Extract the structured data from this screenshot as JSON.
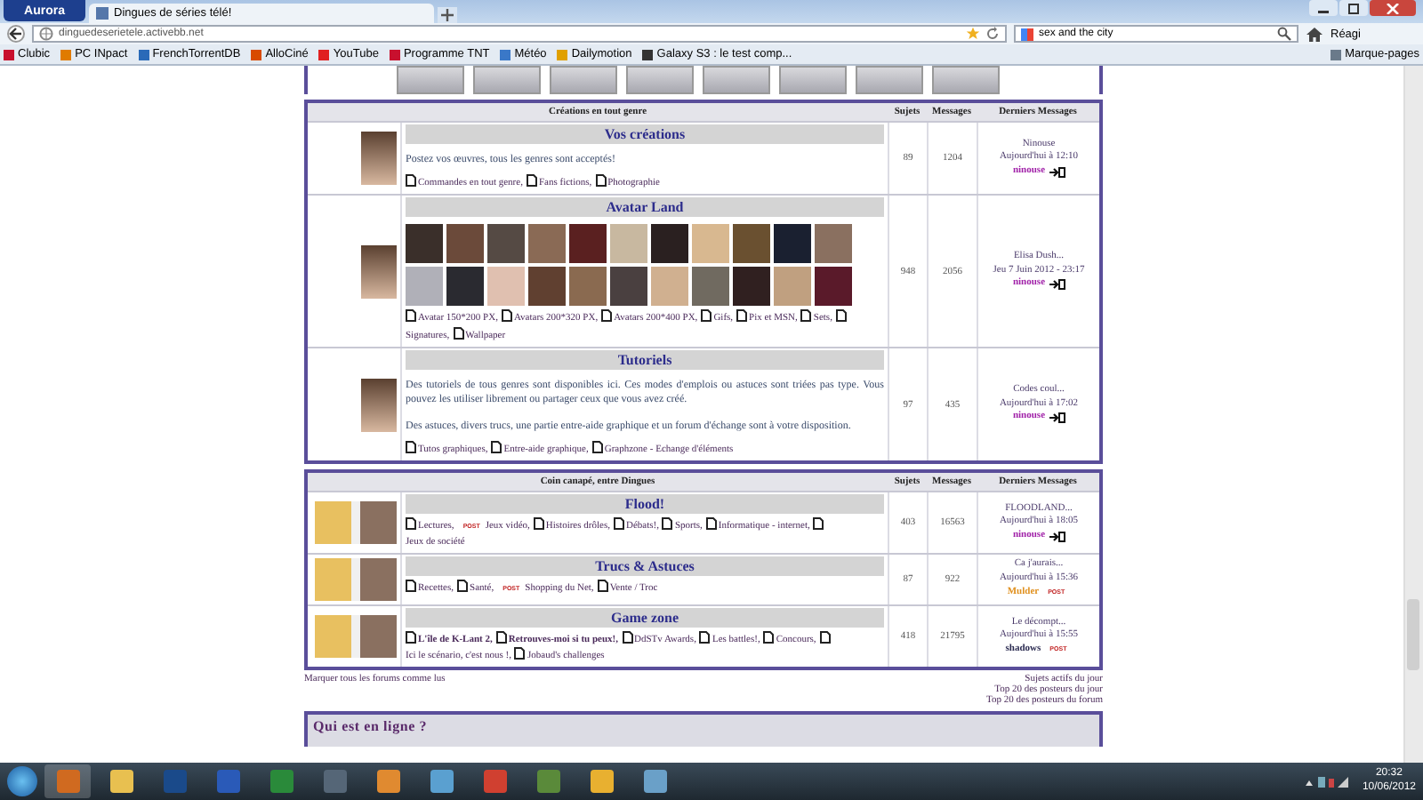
{
  "browser": {
    "app_menu": "Aurora",
    "tab_title": "Dingues de séries télé!",
    "url": "dinguedeserietele.activebb.net",
    "search_value": "sex and the city",
    "toolbar_label": "Réagi",
    "bookmarks": [
      "Clubic",
      "PC INpact",
      "FrenchTorrentDB",
      "AlloCiné",
      "YouTube",
      "Programme TNT",
      "Météo",
      "Dailymotion",
      "Galaxy S3 : le test comp..."
    ],
    "bookmarks_menu": "Marque-pages"
  },
  "sections": [
    {
      "title": "Créations en tout genre",
      "columns": [
        "Sujets",
        "Messages",
        "Derniers Messages"
      ],
      "forums": [
        {
          "kind": "text",
          "title": "Vos créations",
          "description": [
            "Postez vos œuvres, tous les genres sont acceptés!"
          ],
          "subforums": [
            {
              "label": "Commandes en tout genre,",
              "unread": false
            },
            {
              "label": "Fans fictions,",
              "unread": false
            },
            {
              "label": "Photographie",
              "unread": false
            }
          ],
          "topics": "89",
          "posts": "1204",
          "last": {
            "title": "Ninouse",
            "date": "Aujourd'hui à 12:10",
            "author": "ninouse",
            "color": "#a020a8"
          }
        },
        {
          "kind": "gallery",
          "title": "Avatar Land",
          "subforums": [
            {
              "label": "Avatar 150*200 PX,",
              "unread": false
            },
            {
              "label": "Avatars 200*320 PX,",
              "unread": false
            },
            {
              "label": "Avatars 200*400 PX,",
              "unread": false
            },
            {
              "label": "Gifs,",
              "unread": false
            },
            {
              "label": "Pix et MSN,",
              "unread": false
            },
            {
              "label": "Sets,",
              "unread": false
            },
            {
              "label": "Signatures,",
              "unread": false
            },
            {
              "label": "Wallpaper",
              "unread": false
            }
          ],
          "topics": "948",
          "posts": "2056",
          "last": {
            "title": "Elisa Dush...",
            "date": "Jeu 7 Juin 2012 - 23:17",
            "author": "ninouse",
            "color": "#a020a8"
          }
        },
        {
          "kind": "text",
          "title": "Tutoriels",
          "description": [
            "Des tutoriels de tous genres sont disponibles ici. Ces modes d'emplois ou astuces sont triées pas type. Vous pouvez les utiliser librement ou partager ceux que vous avez créé.",
            "Des astuces, divers trucs, une partie entre-aide graphique et un forum d'échange sont à votre disposition."
          ],
          "subforums": [
            {
              "label": "Tutos graphiques,",
              "unread": false
            },
            {
              "label": "Entre-aide graphique,",
              "unread": false
            },
            {
              "label": "Graphzone - Echange d'éléments",
              "unread": false
            }
          ],
          "topics": "97",
          "posts": "435",
          "last": {
            "title": "Codes coul...",
            "date": "Aujourd'hui à 17:02",
            "author": "ninouse",
            "color": "#a020a8"
          }
        }
      ]
    },
    {
      "title": "Coin canapé, entre Dingues",
      "columns": [
        "Sujets",
        "Messages",
        "Derniers Messages"
      ],
      "forums": [
        {
          "kind": "text",
          "title": "Flood!",
          "subforums": [
            {
              "label": "Lectures,",
              "unread": false
            },
            {
              "label": "Jeux vidéo,",
              "badge": "POST",
              "unread": false
            },
            {
              "label": "Histoires drôles,",
              "unread": false
            },
            {
              "label": "Débats!,",
              "unread": false
            },
            {
              "label": "Sports,",
              "unread": false
            },
            {
              "label": "Informatique - internet,",
              "unread": false
            },
            {
              "label": "Jeux de société",
              "unread": false
            }
          ],
          "topics": "403",
          "posts": "16563",
          "last": {
            "title": "FLOODLAND...",
            "date": "Aujourd'hui à 18:05",
            "author": "ninouse",
            "color": "#a020a8"
          }
        },
        {
          "kind": "text",
          "title": "Trucs & Astuces",
          "subforums": [
            {
              "label": "Recettes,",
              "unread": false
            },
            {
              "label": "Santé,",
              "unread": false
            },
            {
              "label": "Shopping du Net,",
              "badge": "POST",
              "unread": false
            },
            {
              "label": "Vente / Troc",
              "unread": false
            }
          ],
          "topics": "87",
          "posts": "922",
          "last": {
            "title": "Ca j'aurais...",
            "date": "Aujourd'hui à 15:36",
            "author": "Mulder",
            "color": "#e0901e",
            "badge": "POST"
          }
        },
        {
          "kind": "text",
          "title": "Game zone",
          "subforums": [
            {
              "label": "L'île de K-Lant 2,",
              "unread": true
            },
            {
              "label": "Retrouves-moi si tu peux!,",
              "unread": true
            },
            {
              "label": "DdSTv Awards,",
              "unread": false
            },
            {
              "label": "Les battles!,",
              "unread": false
            },
            {
              "label": "Concours,",
              "unread": false
            },
            {
              "label": "Ici le scénario, c'est nous !,",
              "unread": false
            },
            {
              "label": "Jobaud's challenges",
              "unread": false
            }
          ],
          "topics": "418",
          "posts": "21795",
          "last": {
            "title": "Le décompt...",
            "date": "Aujourd'hui à 15:55",
            "author": "shadows",
            "color": "#2a2a50",
            "badge": "POST"
          }
        }
      ]
    }
  ],
  "footer": {
    "mark_read": "Marquer tous les forums comme lus",
    "links": [
      "Sujets actifs du jour",
      "Top 20 des posteurs du jour",
      "Top 20 des posteurs du forum"
    ]
  },
  "who_online": "Qui est en ligne ?",
  "taskbar": {
    "time": "20:32",
    "date": "10/06/2012"
  }
}
